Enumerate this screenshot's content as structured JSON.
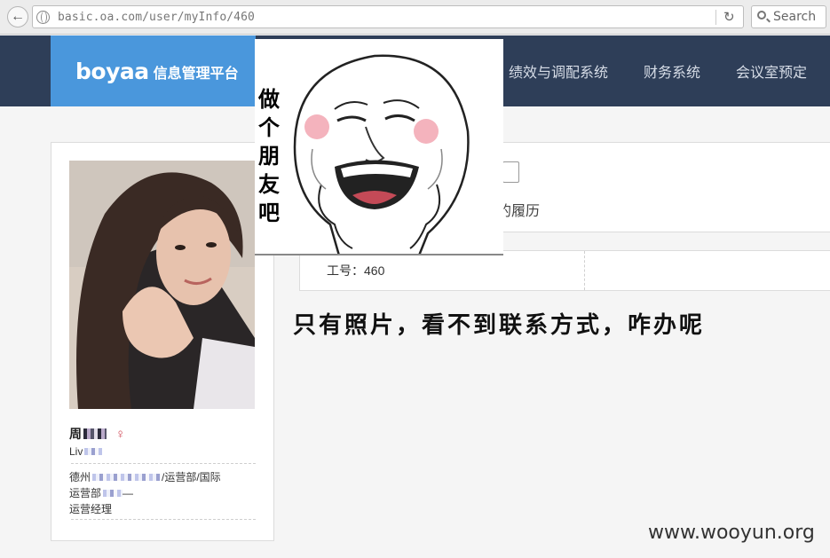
{
  "browser": {
    "url": "basic.oa.com/user/myInfo/460",
    "search_placeholder": "Search"
  },
  "header": {
    "logo_brand": "boyaa",
    "logo_subtitle": "信息管理平台",
    "nav_items": [
      "绩效与调配系统",
      "财务系统",
      "会议室预定"
    ]
  },
  "profile": {
    "name_prefix": "周",
    "gender_symbol": "♀",
    "line1_prefix": "Liv",
    "dept_line1_prefix": "德州",
    "dept_line1_suffix": "/运营部/国际",
    "dept_line2_prefix": "运营部",
    "dept_line2_suffix": "—",
    "position": "运营经理"
  },
  "main": {
    "tab_label": "的履历",
    "employee_no": "工号：460"
  },
  "meme": {
    "text_chars": [
      "做",
      "个",
      "朋",
      "友",
      "吧"
    ]
  },
  "caption": "只有照片，看不到联系方式，咋办呢",
  "watermark": "www.wooyun.org",
  "colors": {
    "header_bg": "#2e3e58",
    "logo_bg": "#4a97dc",
    "female": "#d04a58"
  }
}
